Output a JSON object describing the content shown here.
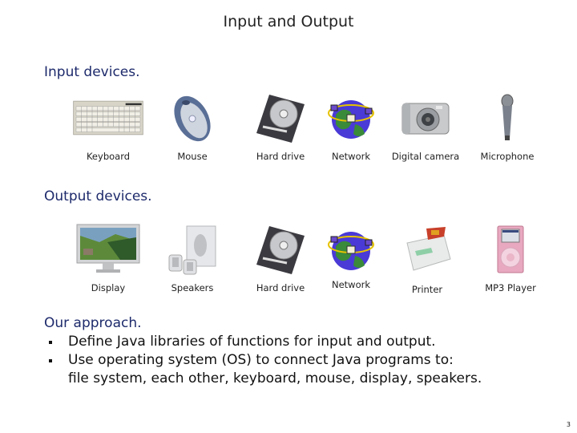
{
  "slide": {
    "title": "Input and Output",
    "page_number": "3"
  },
  "input_section": {
    "heading": "Input devices.",
    "devices": [
      {
        "label": "Keyboard",
        "icon": "keyboard-icon"
      },
      {
        "label": "Mouse",
        "icon": "mouse-icon"
      },
      {
        "label": "Hard drive",
        "icon": "hard-drive-icon"
      },
      {
        "label": "Network",
        "icon": "network-globe-icon"
      },
      {
        "label": "Digital camera",
        "icon": "camera-icon"
      },
      {
        "label": "Microphone",
        "icon": "microphone-icon"
      }
    ]
  },
  "output_section": {
    "heading": "Output devices.",
    "devices": [
      {
        "label": "Display",
        "icon": "display-icon"
      },
      {
        "label": "Speakers",
        "icon": "speakers-icon"
      },
      {
        "label": "Hard drive",
        "icon": "hard-drive-icon"
      },
      {
        "label": "Network",
        "icon": "network-globe-icon"
      },
      {
        "label": "Printer",
        "icon": "printer-icon"
      },
      {
        "label": "MP3 Player",
        "icon": "mp3-player-icon"
      }
    ]
  },
  "approach": {
    "heading": "Our approach.",
    "bullets": [
      "Define Java libraries of functions for input and output.",
      "Use operating system (OS) to connect Java programs to:"
    ],
    "continuation": "file system, each other, keyboard, mouse, display, speakers."
  }
}
